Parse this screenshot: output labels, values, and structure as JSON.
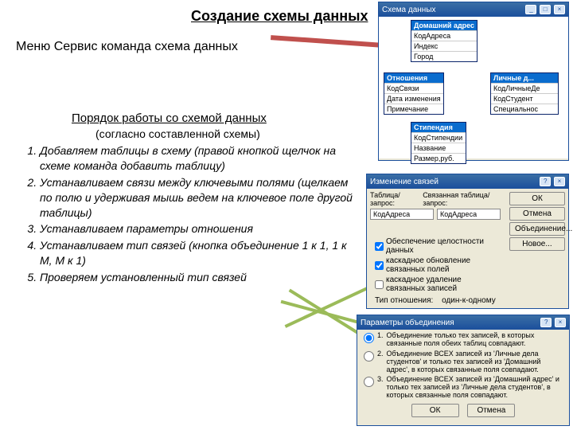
{
  "title": "Создание схемы данных",
  "menu_line": "Меню Сервис команда схема данных",
  "subtitle": "Порядок работы со схемой данных",
  "sub2": "(согласно составленной схемы)",
  "steps": [
    "Добавляем таблицы в схему (правой кнопкой щелчок на схеме команда добавить таблицу)",
    "Устанавливаем связи между ключевыми полями (щелкаем по полю и удерживая мышь ведем на ключевое поле другой таблицы)",
    "Устанавливаем параметры отношения",
    "Устанавливаем тип связей (кнопка объединение 1 к 1, 1 к М, М к 1)",
    "Проверяем установленный тип связей"
  ],
  "schemaWin": {
    "title": "Схема данных",
    "tables": {
      "t1": {
        "name": "Домашний адрес",
        "fields": [
          "КодАдреса",
          "Индекс",
          "Город"
        ]
      },
      "t2": {
        "name": "Отношения",
        "fields": [
          "КодСвязи",
          "Дата изменения",
          "Примечание"
        ]
      },
      "t3": {
        "name": "Личные д...",
        "fields": [
          "КодЛичныеДе",
          "КодСтудент",
          "Специальнос"
        ]
      },
      "t4": {
        "name": "Стипендия",
        "fields": [
          "КодСтипендии",
          "Название",
          "Размер,руб."
        ]
      }
    }
  },
  "relWin": {
    "title": "Изменение связей",
    "lblA": "Таблица/запрос:",
    "lblB": "Связанная таблица/запрос:",
    "fieldA": "КодАдреса",
    "fieldB": "КодАдреса",
    "btns": {
      "ok": "ОК",
      "cancel": "Отмена",
      "join": "Объединение...",
      "new": "Новое..."
    },
    "chk1": "Обеспечение целостности данных",
    "chk2": "каскадное обновление связанных полей",
    "chk3": "каскадное удаление связанных записей",
    "typelbl": "Тип отношения:",
    "typeval": "один-к-одному"
  },
  "joinWin": {
    "title": "Параметры объединения",
    "o1n": "1.",
    "o1": "Объединение только тех записей, в которых связанные поля обеих таблиц совпадают.",
    "o2n": "2.",
    "o2": "Объединение ВСЕХ записей из 'Личные дела студентов' и только тех записей из 'Домашний адрес', в которых связанные поля совпадают.",
    "o3n": "3.",
    "o3": "Объединение ВСЕХ записей из 'Домашний адрес' и только тех записей из 'Личные дела студентов', в которых связанные поля совпадают.",
    "ok": "ОК",
    "cancel": "Отмена"
  },
  "ctrl": {
    "min": "_",
    "max": "□",
    "close": "×",
    "help": "?"
  }
}
